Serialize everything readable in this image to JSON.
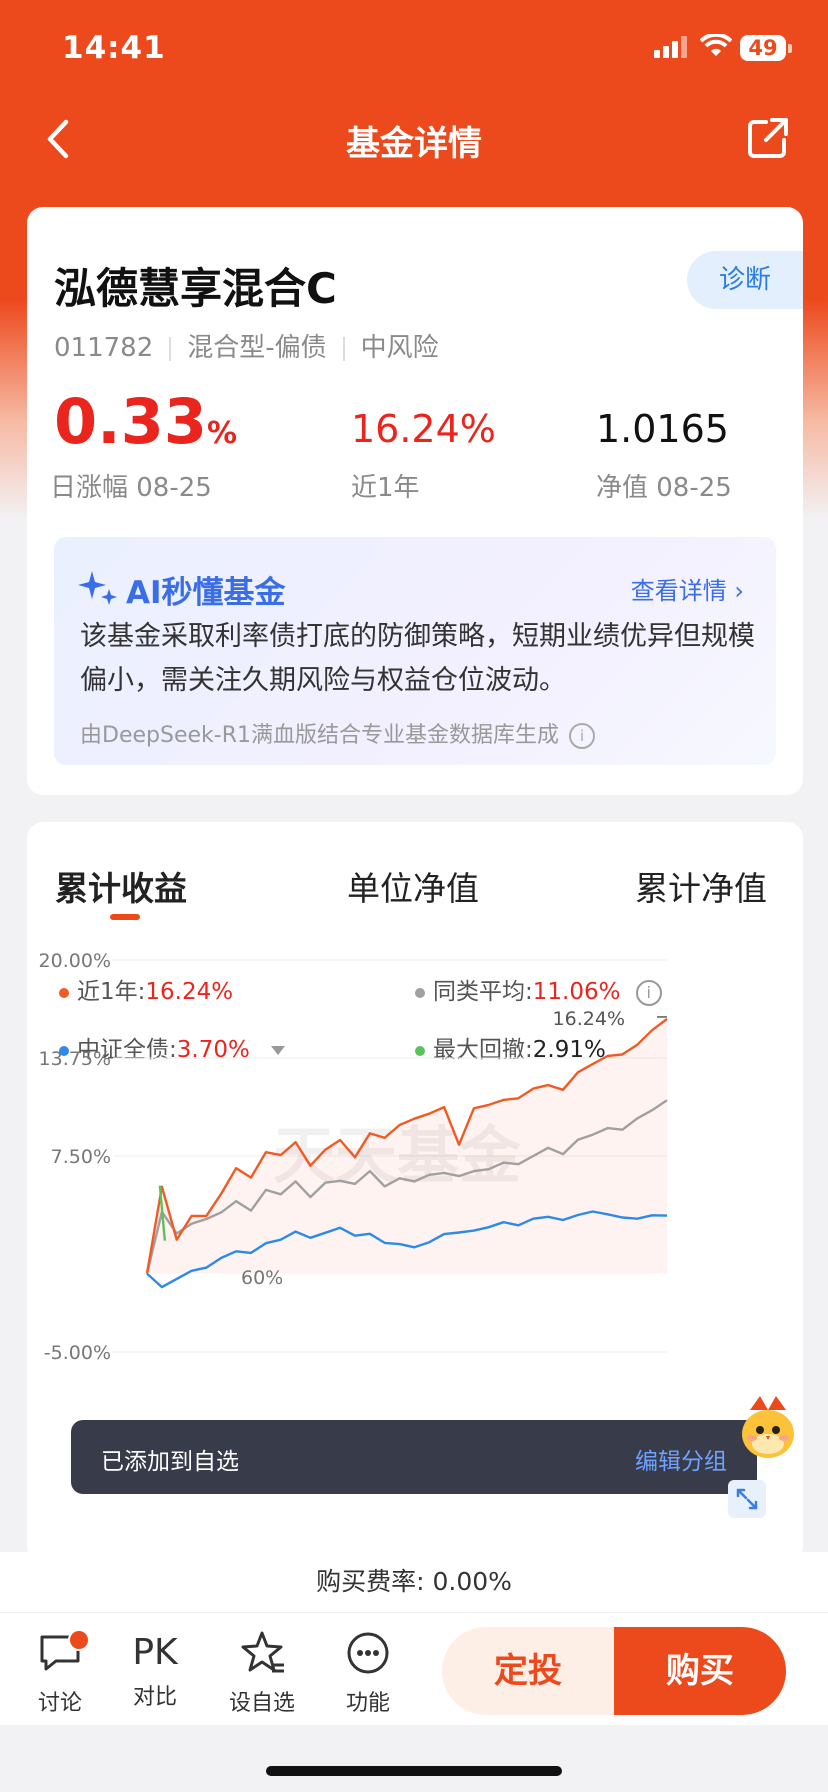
{
  "status": {
    "time": "14:41",
    "battery": "49"
  },
  "nav": {
    "title": "基金详情"
  },
  "fund": {
    "name": "泓德慧享混合C",
    "diagnose_label": "诊断",
    "code": "011782",
    "type": "混合型-偏债",
    "risk": "中风险",
    "daily_change_value": "0.33",
    "daily_change_unit": "%",
    "daily_change_label": "日涨幅 08-25",
    "year_return": "16.24%",
    "year_return_label": "近1年",
    "nav_value": "1.0165",
    "nav_label": "净值 08-25"
  },
  "ai": {
    "title": "AI秒懂基金",
    "link": "查看详情",
    "text": "该基金采取利率债打底的防御策略，短期业绩优异但规模偏小，需关注久期风险与权益仓位波动。",
    "footer": "由DeepSeek-R1满血版结合专业基金数据库生成"
  },
  "tabs": [
    {
      "label": "累计收益",
      "active": true
    },
    {
      "label": "单位净值",
      "active": false
    },
    {
      "label": "累计净值",
      "active": false
    }
  ],
  "legend": [
    {
      "label": "近1年:",
      "value": "16.24%",
      "color": "#f25a25"
    },
    {
      "label": "同类平均:",
      "value": "11.06%",
      "color": "#a0a0a0"
    },
    {
      "label": "中证全债:",
      "value": "3.70%",
      "color": "#2d8ae8"
    },
    {
      "label": "最大回撤:",
      "value": "2.91%",
      "color": "#5ac25a"
    }
  ],
  "chart_data": {
    "type": "line",
    "yticks": [
      "20.00%",
      "13.75%",
      "7.50%",
      "-5.00%"
    ],
    "ylim": [
      -5.0,
      20.0
    ],
    "end_label": "16.24%",
    "watermark": "天天基金",
    "partial_label": "60%",
    "series": [
      {
        "name": "近1年",
        "color": "#f25a25",
        "values": [
          0.0,
          5.6,
          2.1,
          3.5,
          3.8,
          5.1,
          6.6,
          6.3,
          7.8,
          7.5,
          8.2,
          7.0,
          7.9,
          8.4,
          7.6,
          9.0,
          8.6,
          9.3,
          10.0,
          10.2,
          10.5,
          8.4,
          10.6,
          10.7,
          10.9,
          11.3,
          11.8,
          11.9,
          11.9,
          12.9,
          13.3,
          13.7,
          14.1,
          14.6,
          15.4,
          16.24
        ]
      },
      {
        "name": "同类平均",
        "color": "#a0a0a0",
        "values": [
          0.0,
          4.0,
          2.5,
          3.0,
          3.6,
          3.9,
          4.5,
          4.2,
          5.4,
          5.0,
          5.7,
          5.0,
          5.8,
          5.8,
          5.9,
          6.6,
          5.5,
          5.9,
          6.0,
          6.3,
          6.3,
          6.4,
          6.6,
          6.6,
          6.9,
          7.1,
          7.5,
          7.9,
          7.8,
          8.6,
          8.8,
          9.1,
          9.3,
          9.9,
          10.3,
          11.06
        ]
      },
      {
        "name": "中证全债",
        "color": "#2d8ae8",
        "values": [
          0.0,
          -0.8,
          -0.4,
          0.0,
          0.5,
          1.0,
          1.3,
          1.5,
          2.0,
          2.1,
          2.5,
          2.4,
          2.6,
          2.8,
          2.6,
          2.6,
          1.9,
          1.7,
          1.8,
          2.0,
          2.4,
          2.8,
          2.8,
          2.9,
          3.1,
          3.2,
          3.5,
          3.5,
          3.6,
          3.8,
          3.9,
          3.6,
          3.7,
          3.5,
          3.6,
          3.7
        ]
      }
    ]
  },
  "toast": {
    "message": "已添加到自选",
    "action": "编辑分组"
  },
  "fee": {
    "text": "购买费率: 0.00%"
  },
  "bottom": {
    "discuss": "讨论",
    "pk_icon": "PK",
    "compare": "对比",
    "watchlist": "设自选",
    "functions": "功能",
    "auto_invest": "定投",
    "buy": "购买"
  }
}
